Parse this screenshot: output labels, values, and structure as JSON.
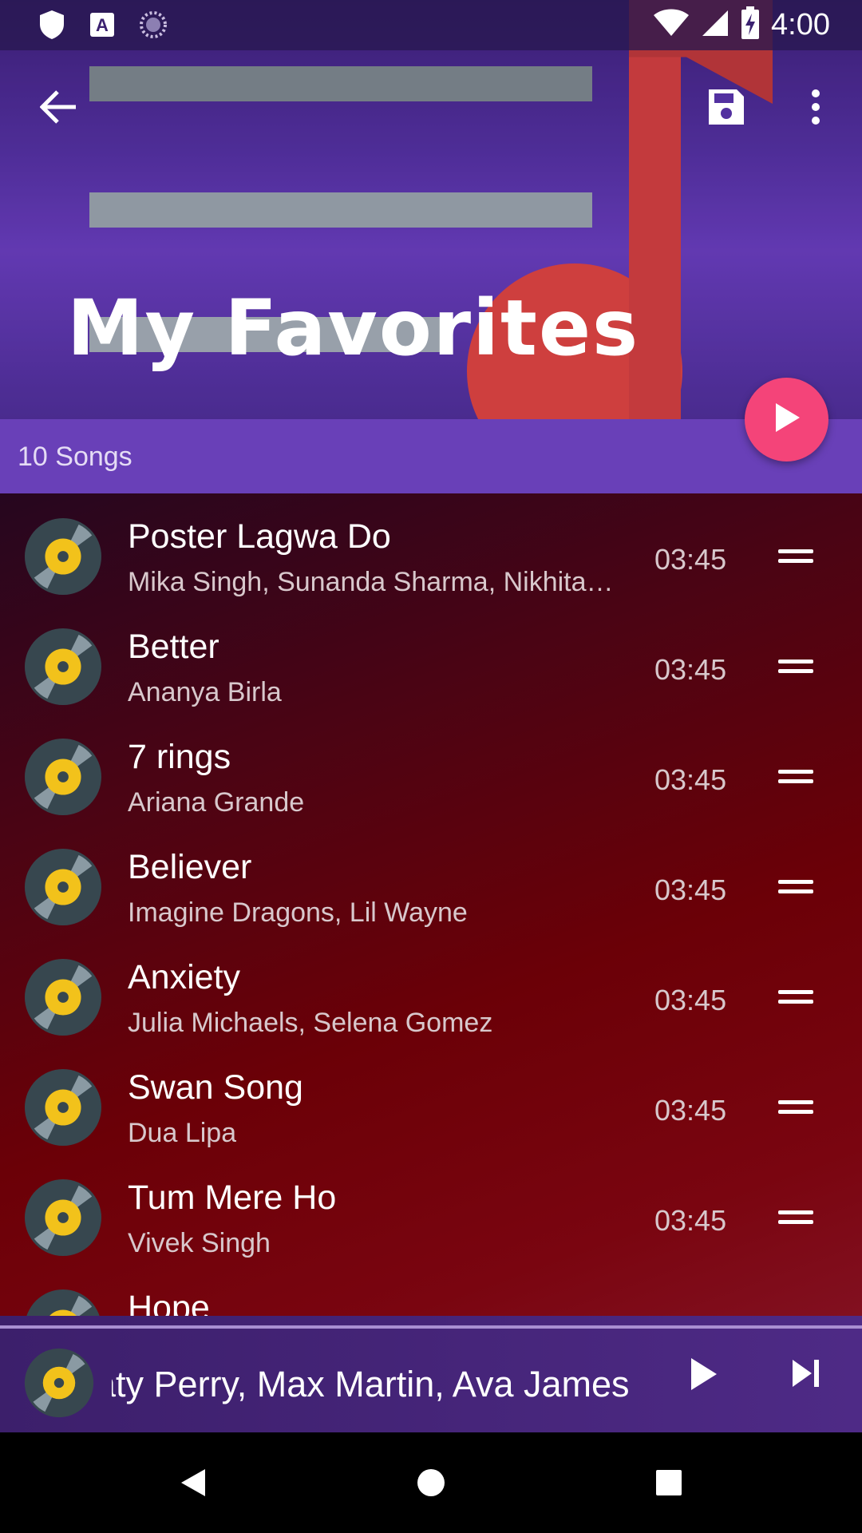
{
  "status_bar": {
    "time": "4:00",
    "left_icons": [
      "shield-icon",
      "keyboard-a-icon",
      "loading-icon"
    ],
    "right_icons": [
      "wifi-icon",
      "cell-signal-icon",
      "battery-charging-icon"
    ]
  },
  "toolbar": {
    "back_icon": "arrow-back-icon",
    "save_icon": "save-icon",
    "more_icon": "more-vert-icon"
  },
  "playlist": {
    "title": "My Favorites",
    "song_count": "10 Songs",
    "play_all_icon": "play-icon"
  },
  "songs": [
    {
      "title": "Poster Lagwa Do",
      "artist": "Mika Singh, Sunanda Sharma, Nikhita…",
      "duration": "03:45"
    },
    {
      "title": "Better",
      "artist": "Ananya Birla",
      "duration": "03:45"
    },
    {
      "title": "7 rings",
      "artist": "Ariana Grande",
      "duration": "03:45"
    },
    {
      "title": "Believer",
      "artist": "Imagine Dragons, Lil Wayne",
      "duration": "03:45"
    },
    {
      "title": "Anxiety",
      "artist": "Julia Michaels, Selena Gomez",
      "duration": "03:45"
    },
    {
      "title": "Swan Song",
      "artist": "Dua Lipa",
      "duration": "03:45"
    },
    {
      "title": "Tum Mere Ho",
      "artist": "Vivek Singh",
      "duration": "03:45"
    },
    {
      "title": "Hope",
      "artist": "",
      "duration": ""
    }
  ],
  "mini_player": {
    "marquee_text": "aty Perry, Max Martin, Ava James",
    "play_icon": "play-icon",
    "next_icon": "skip-next-icon"
  },
  "nav_bar": {
    "back_icon": "nav-back-icon",
    "home_icon": "nav-home-icon",
    "recents_icon": "nav-recents-icon"
  },
  "colors": {
    "header_purple": "#5331a0",
    "strip_purple": "#6940b8",
    "fab_pink": "#f44479",
    "list_red": "#6b0007",
    "disc_yellow": "#f2c21b"
  }
}
